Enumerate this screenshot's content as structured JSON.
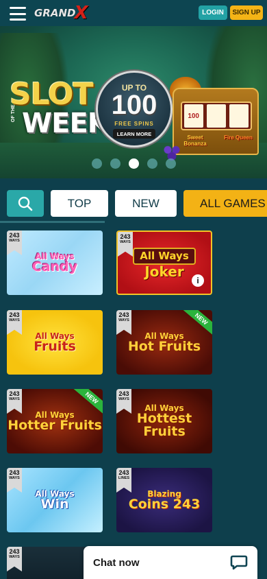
{
  "header": {
    "logo_text": "GRAND",
    "logo_x": "X",
    "login_label": "LOGIN",
    "signup_label": "SIGN UP",
    "colors": {
      "login": "#23a2a5",
      "signup": "#f4b416",
      "bg": "#0d4551"
    }
  },
  "banner": {
    "title_line1": "SLOT",
    "title_of_the": "OF THE",
    "title_line2": "WEEK",
    "badge_up_to": "UP TO",
    "badge_amount": "100",
    "badge_sub": "FREE SPINS",
    "badge_cta": "LEARN MORE",
    "machine_reels": [
      "100",
      "",
      ""
    ],
    "machine_label_left": "Sweet Bonanza",
    "machine_label_right": "Fire Queen",
    "carousel_total": 5,
    "carousel_active_index": 2
  },
  "filters": {
    "search_icon": "search-icon",
    "tabs": [
      "TOP",
      "NEW",
      "ALL GAMES"
    ]
  },
  "games": [
    {
      "line1": "All Ways",
      "line2": "Candy",
      "ways": "243",
      "ways_label": "WAYS",
      "is_new": false
    },
    {
      "line1": "All Ways",
      "line2": "Joker",
      "ways": "243",
      "ways_label": "WAYS",
      "is_new": false,
      "has_info": true,
      "info_glyph": "i"
    },
    {
      "line1": "All Ways",
      "line2": "Fruits",
      "ways": "243",
      "ways_label": "WAYS",
      "is_new": false
    },
    {
      "line1": "All Ways",
      "line2": "Hot Fruits",
      "ways": "243",
      "ways_label": "WAYS",
      "is_new": true,
      "new_label": "NEW"
    },
    {
      "line1": "All Ways",
      "line2": "Hotter Fruits",
      "ways": "243",
      "ways_label": "WAYS",
      "is_new": true,
      "new_label": "NEW"
    },
    {
      "line1": "All Ways",
      "line2": "Hottest Fruits",
      "ways": "243",
      "ways_label": "WAYS",
      "is_new": false
    },
    {
      "line1": "All Ways",
      "line2": "Win",
      "ways": "243",
      "ways_label": "WAYS",
      "is_new": false
    },
    {
      "line1": "Blazing",
      "line2": "Coins 243",
      "ways": "243",
      "ways_label": "LINES",
      "is_new": false
    },
    {
      "line1": "",
      "line2": "",
      "ways": "243",
      "ways_label": "WAYS",
      "is_new": false
    }
  ],
  "chat": {
    "label": "Chat now",
    "icon": "chat-bubble-icon"
  }
}
